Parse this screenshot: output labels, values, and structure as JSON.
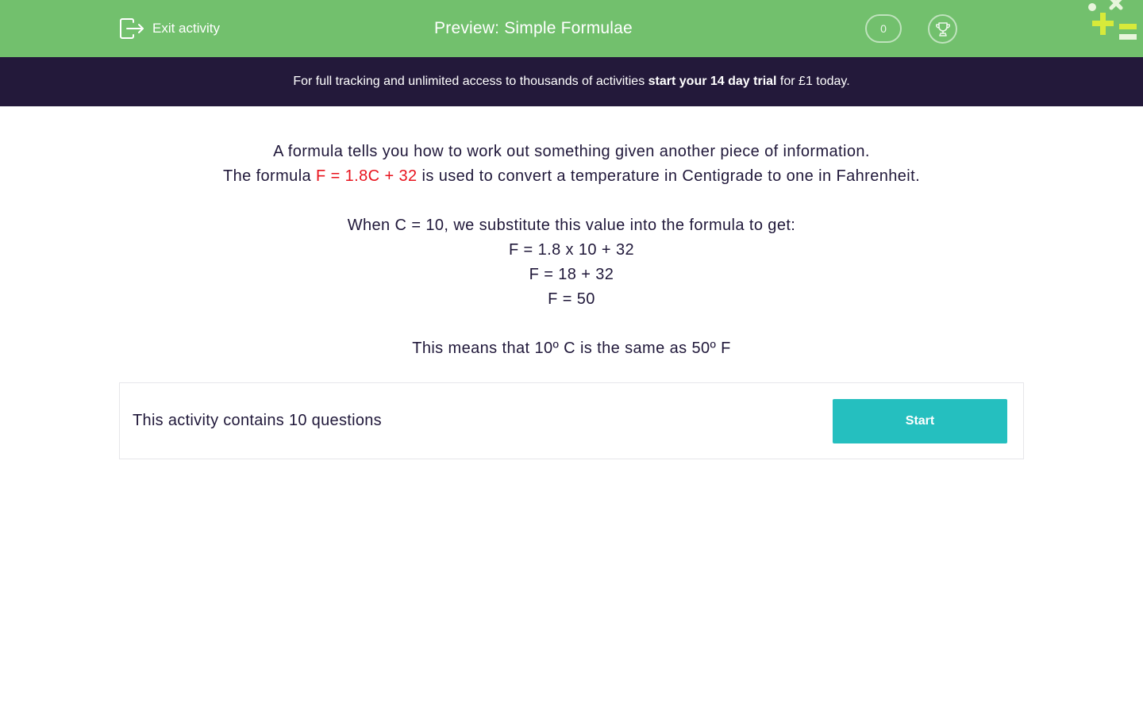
{
  "header": {
    "exit_label": "Exit activity",
    "title": "Preview: Simple Formulae",
    "score": "0",
    "bar_color": "#72c06d"
  },
  "promo": {
    "prefix": "For full tracking and unlimited access to thousands of activities ",
    "highlight": "start your 14 day trial",
    "suffix": " for £1 today.",
    "bar_color": "#23193a"
  },
  "intro": {
    "line1": "A formula tells you how to work out something given another piece of information.",
    "line2_prefix": "The formula ",
    "line2_formula": "F = 1.8C + 32",
    "line2_suffix": " is used to convert a temperature in Centigrade to one in Fahrenheit.",
    "line3": "When C = 10, we substitute this value into the formula to get:",
    "step1": "F = 1.8 x 10 + 32",
    "step2": "F = 18 + 32",
    "step3": "F = 50",
    "conclusion": "This means that 10º C is the same as 50º F",
    "formula_color": "#e8131d"
  },
  "activity": {
    "text": "This activity contains 10 questions",
    "start_label": "Start",
    "button_color": "#25bfbf"
  },
  "icons": {
    "exit": "exit-icon",
    "trophy": "trophy-icon",
    "logo": "math-symbols-logo"
  }
}
